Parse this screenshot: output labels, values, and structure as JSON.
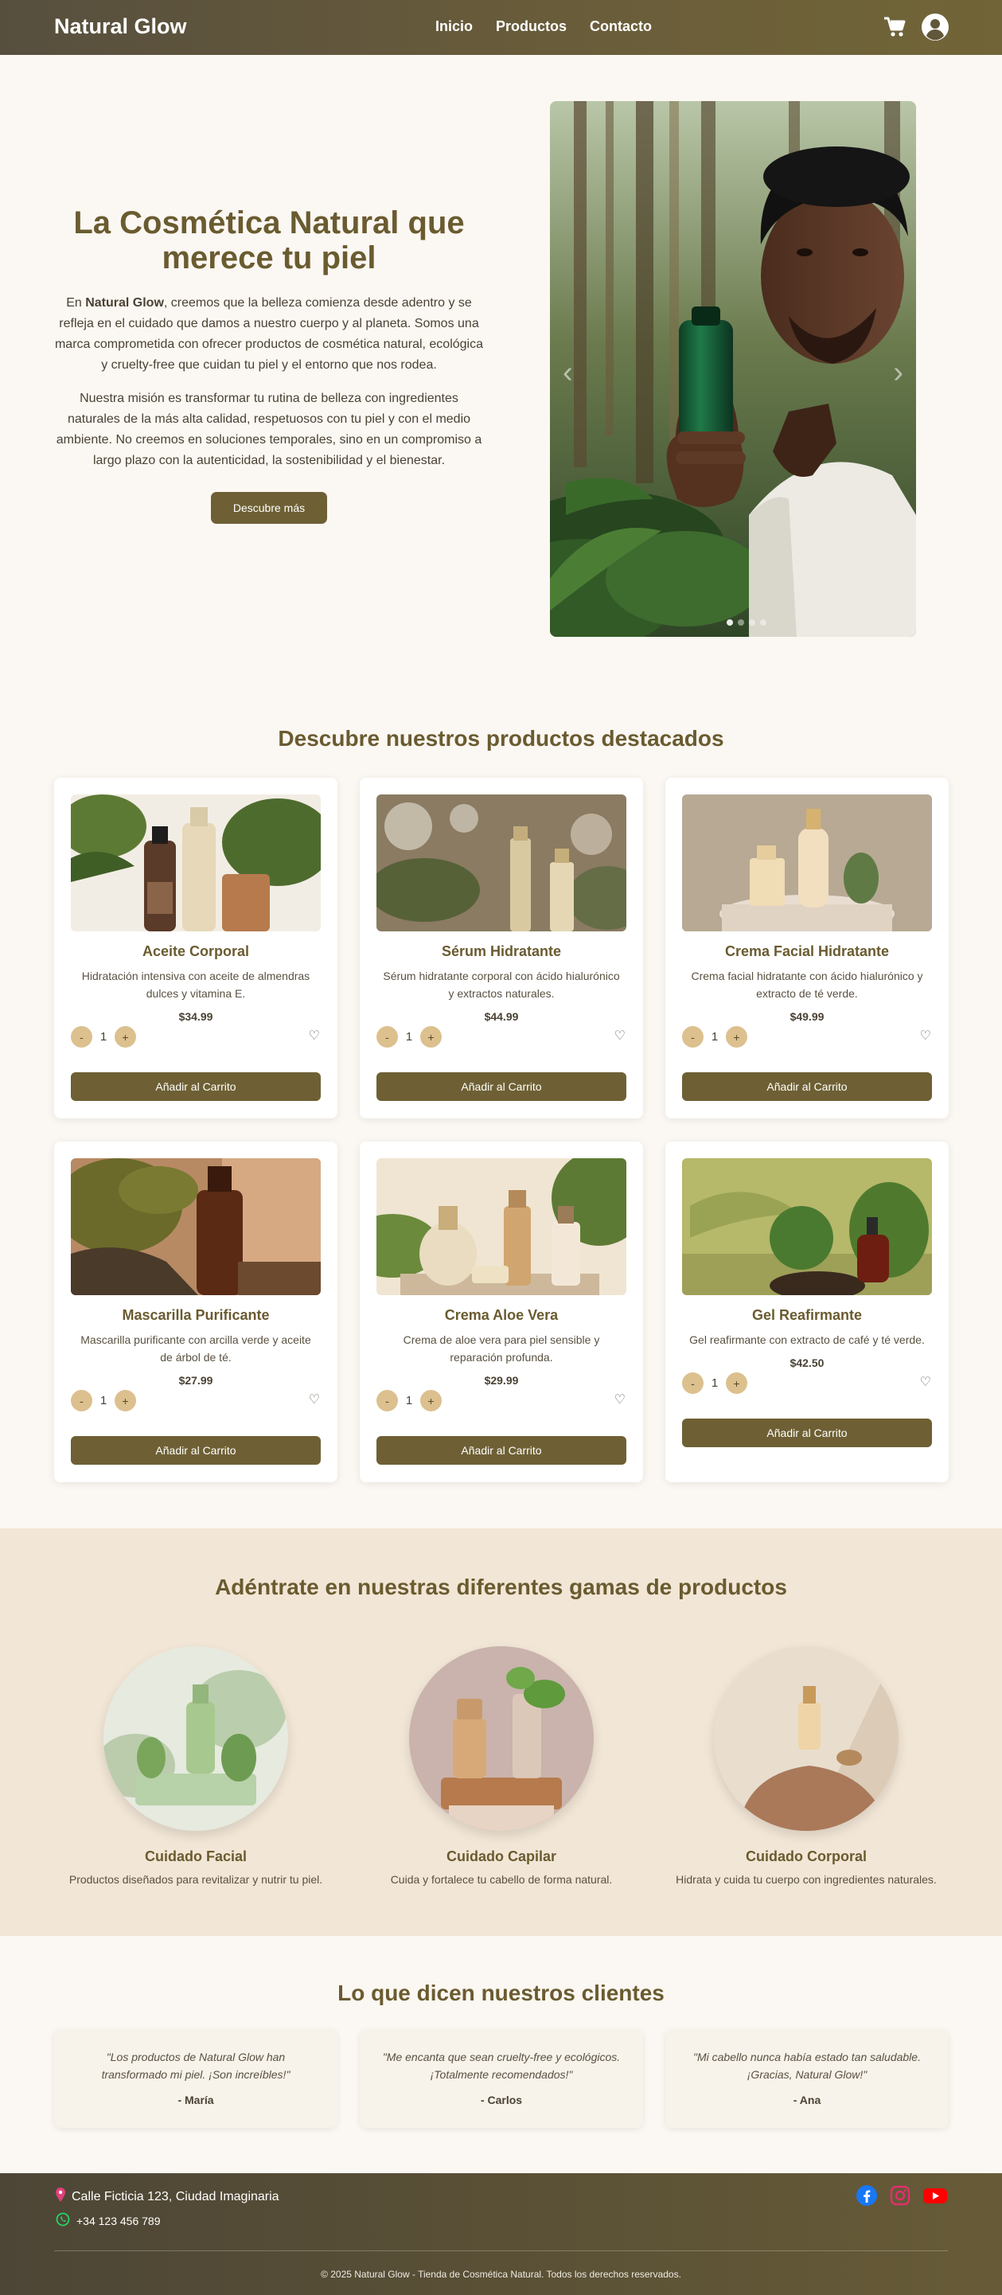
{
  "nav": {
    "brand": "Natural Glow",
    "links": [
      "Inicio",
      "Productos",
      "Contacto"
    ],
    "icons": [
      "cart-icon",
      "user-account-icon"
    ]
  },
  "hero": {
    "title": "La Cosmética Natural que merece tu piel",
    "p1_before": "En ",
    "p1_brand": "Natural Glow",
    "p1_after": ", creemos que la belleza comienza desde adentro y se refleja en el cuidado que damos a nuestro cuerpo y al planeta. Somos una marca comprometida con ofrecer productos de cosmética natural, ecológica y cruelty-free que cuidan tu piel y el entorno que nos rodea.",
    "p2": "Nuestra misión es transformar tu rutina de belleza con ingredientes naturales de la más alta calidad, respetuosos con tu piel y con el medio ambiente. No creemos en soluciones temporales, sino en un compromiso a largo plazo con la autenticidad, la sostenibilidad y el bienestar.",
    "cta": "Descubre más",
    "carousel_prev": "‹",
    "carousel_next": "›",
    "carousel_slides": 4,
    "carousel_active": 1
  },
  "featured": {
    "title": "Descubre nuestros productos destacados",
    "add_label": "Añadir al Carrito",
    "minus": "-",
    "plus": "+",
    "products": [
      {
        "name": "Aceite Corporal",
        "desc": "Hidratación intensiva con aceite de almendras dulces y vitamina E.",
        "price": "$34.99",
        "qty": "1"
      },
      {
        "name": "Sérum Hidratante",
        "desc": "Sérum hidratante corporal con ácido hialurónico y extractos naturales.",
        "price": "$44.99",
        "qty": "1"
      },
      {
        "name": "Crema Facial Hidratante",
        "desc": "Crema facial hidratante con ácido hialurónico y extracto de té verde.",
        "price": "$49.99",
        "qty": "1"
      },
      {
        "name": "Mascarilla Purificante",
        "desc": "Mascarilla purificante con arcilla verde y aceite de árbol de té.",
        "price": "$27.99",
        "qty": "1"
      },
      {
        "name": "Crema Aloe Vera",
        "desc": "Crema de aloe vera para piel sensible y reparación profunda.",
        "price": "$29.99",
        "qty": "1"
      },
      {
        "name": "Gel Reafirmante",
        "desc": "Gel reafirmante con extracto de café y té verde.",
        "price": "$42.50",
        "qty": "1"
      }
    ]
  },
  "ranges": {
    "title": "Adéntrate en nuestras diferentes gamas de productos",
    "items": [
      {
        "name": "Cuidado Facial",
        "desc": "Productos diseñados para revitalizar y nutrir tu piel."
      },
      {
        "name": "Cuidado Capilar",
        "desc": "Cuida y fortalece tu cabello de forma natural."
      },
      {
        "name": "Cuidado Corporal",
        "desc": "Hidrata y cuida tu cuerpo con ingredientes naturales."
      }
    ]
  },
  "testimonials": {
    "title": "Lo que dicen nuestros clientes",
    "items": [
      {
        "quote": "\"Los productos de Natural Glow han transformado mi piel. ¡Son increíbles!\"",
        "author": "- María"
      },
      {
        "quote": "\"Me encanta que sean cruelty-free y ecológicos. ¡Totalmente recomendados!\"",
        "author": "- Carlos"
      },
      {
        "quote": "\"Mi cabello nunca había estado tan saludable. ¡Gracias, Natural Glow!\"",
        "author": "- Ana"
      }
    ]
  },
  "footer": {
    "address": "Calle Ficticia 123, Ciudad Imaginaria",
    "phone": "+34 123 456 789",
    "copyright": "© 2025 Natural Glow - Tienda de Cosmética Natural. Todos los derechos reservados.",
    "social": [
      "facebook-icon",
      "instagram-icon",
      "youtube-icon"
    ],
    "colors": {
      "facebook": "#1877f2",
      "instagram": "#e1306c",
      "youtube": "#ff0000",
      "pin": "#e0407a",
      "whatsapp": "#25d366"
    }
  },
  "colors": {
    "accent": "#6e6034",
    "heading": "#6a5b30",
    "qty_button": "#dcc08e",
    "ranges_bg": "#f2e6d6",
    "page_bg": "#fbf7f2"
  }
}
